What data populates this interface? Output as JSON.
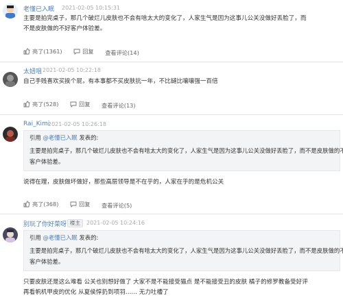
{
  "colors": {
    "author": "#4f7fb8",
    "muted": "#999999",
    "text": "#333333",
    "quote_bg": "#f3f4f6"
  },
  "comments": [
    {
      "author": "老懂已入眠",
      "time": "2021-02-05 10:15:31",
      "avatar_icon": "cartoon-avatar-icon",
      "lines": [
        "主要是拍完桌子，那几个破烂儿皮肤也不会有啥太大的变化了，人家生气是因为这事儿公关没做好丢脸了，而",
        "不是皮肤做的不好客户体验差。"
      ],
      "like": "亮了(1361)",
      "reply": "回复",
      "view": "查看评论(14)"
    },
    {
      "author": "太妞咀",
      "time": "2021-02-05 10:22:18",
      "avatar_icon": "photo-avatar-icon",
      "lines": [
        "自己手贱喜欢买挨个屁，有本事都不买皮肤抗一年，不比鐽比嚷嚷强一百倍"
      ],
      "like": "亮了(528)",
      "reply": "回复",
      "view": "查看评论(13)"
    },
    {
      "author": "Rai_Kimi",
      "time": "2021-02-05 10:26:18",
      "avatar_icon": "character-avatar-icon",
      "quote": {
        "prefix": "引用",
        "author": "@老懂已入眠",
        "suffix": "发表的:",
        "lines": [
          "主要是拍完桌子，那几个破烂儿皮肤也不会有啥太大的变化了，人家生气是因为这事儿公关没做好丢脸了，而不是皮肤做的不好",
          "客户体验差。"
        ]
      },
      "lines": [
        "说得在理，皮肤做坏做好，那些高层领导是不在乎的，人家在乎的是危机公关"
      ],
      "like": "亮了(368)",
      "reply": "回复",
      "view": "查看评论(5)"
    },
    {
      "author": "别玩了你好菜呀",
      "tag": "楼主",
      "time": "2021-02-05 10:24:16",
      "avatar_icon": "anime-avatar-icon",
      "quote": {
        "prefix": "引用",
        "author": "@老懂已入眠",
        "suffix": "发表的:",
        "lines": [
          "主要是拍完桌子，那几个破烂儿皮肤也不会有啥太大的变化了，人家生气是因为这事儿公关没做好丢脸了，而不是皮肤做的不好",
          "客户体验差。"
        ]
      },
      "lines": [
        "只要皮肤还是这么难看 公关也别想好做了 大家不是不能接受猫点 是不能接受丑的皮肤 橘子的修罗教备受好评",
        "再看帆机甲皮的优化 从夏侯惇扔到项羽…… 无力吐槽了"
      ]
    }
  ]
}
